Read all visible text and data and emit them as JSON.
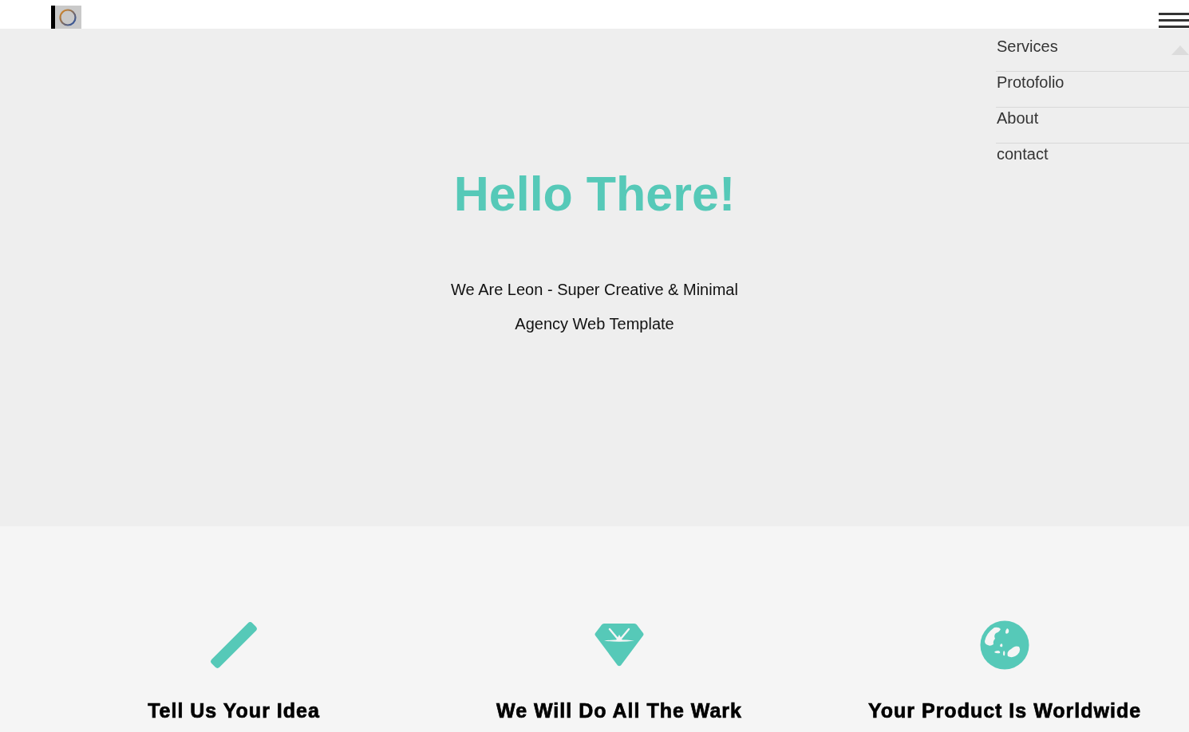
{
  "nav": {
    "expanded": true,
    "items": [
      "Services",
      "Protofolio",
      "About",
      "contact"
    ]
  },
  "hero": {
    "title": "Hello There!",
    "subtitle": "We Are Leon - Super Creative & Minimal Agency Web Template"
  },
  "features": [
    {
      "title": "Tell Us Your Idea"
    },
    {
      "title": "We Will Do All The Wark"
    },
    {
      "title": "Your Product Is Worldwide"
    }
  ]
}
